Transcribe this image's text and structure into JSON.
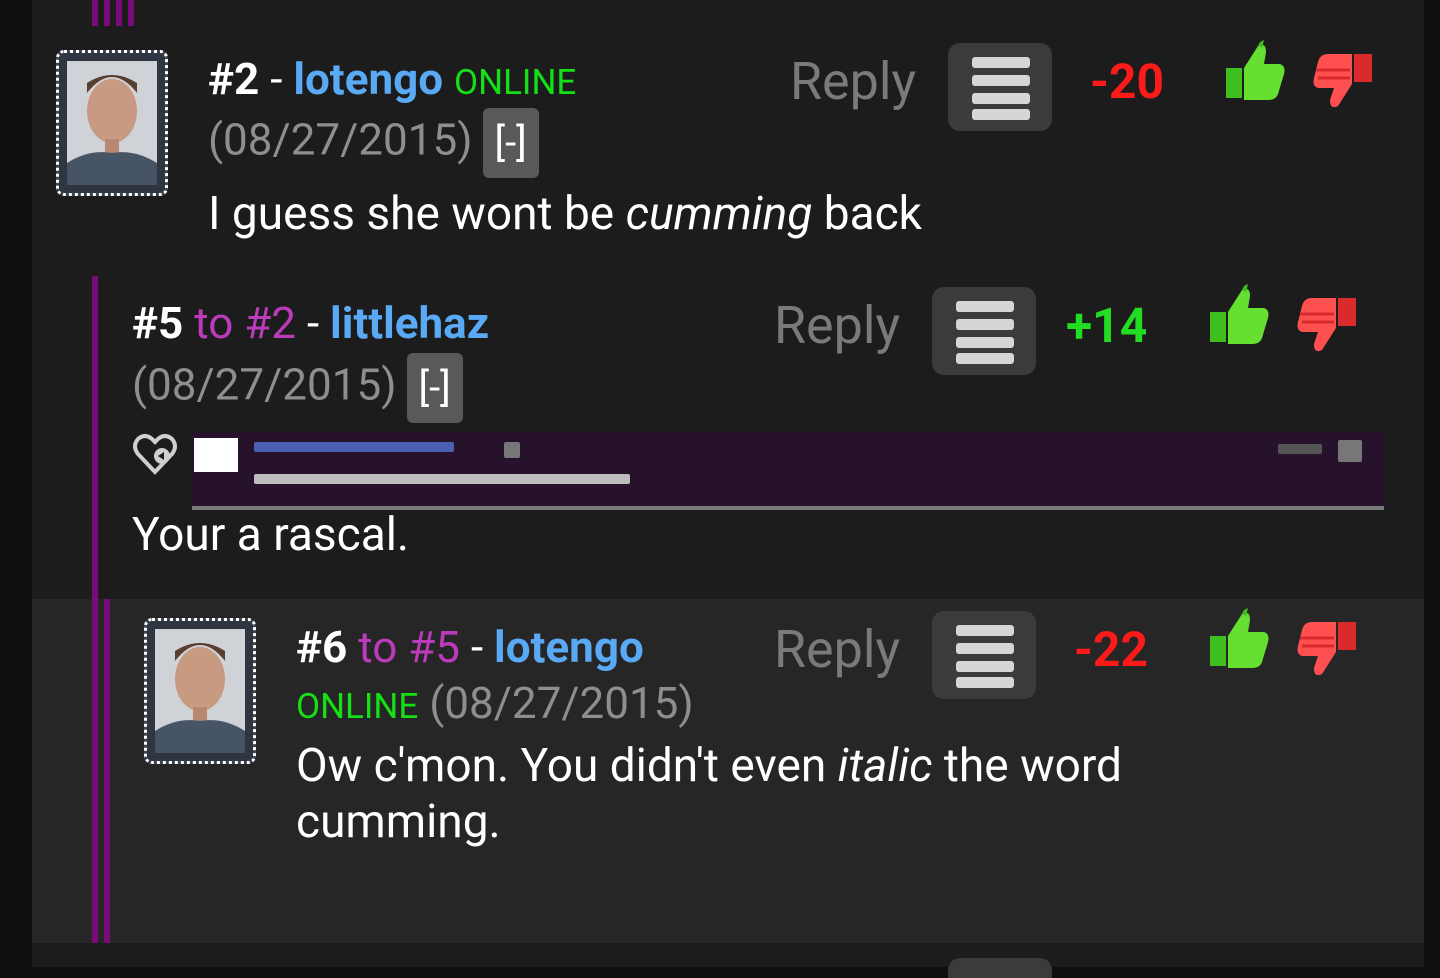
{
  "comments": [
    {
      "number": "#2",
      "username": "lotengo",
      "online": "ONLINE",
      "date": "(08/27/2015)",
      "collapse": "[-]",
      "reply": "Reply",
      "score": "-20",
      "body_parts": [
        "I guess she wont be ",
        "cumming",
        " back"
      ]
    },
    {
      "number": "#5",
      "to_label": "to #2",
      "username": "littlehaz",
      "date": "(08/27/2015)",
      "collapse": "[-]",
      "reply": "Reply",
      "score": "+14",
      "body": "Your a rascal."
    },
    {
      "number": "#6",
      "to_label": "to #5",
      "username": "lotengo",
      "online": "ONLINE",
      "date": "(08/27/2015)",
      "reply": "Reply",
      "score": "-22",
      "body_parts": [
        "Ow c'mon. You didn't even ",
        "italic",
        " the word",
        "cumming."
      ]
    }
  ],
  "colors": {
    "background": "#1c1c1c",
    "username": "#5aa9f5",
    "online": "#15e015",
    "reply_ref": "#bb3bbb",
    "negative_score": "#ff1a1a",
    "positive_score": "#22dd22",
    "thread_stripe": "#7a0a7a"
  },
  "icons": {
    "menu": "hamburger-icon",
    "upvote": "thumbs-up-icon",
    "downvote": "thumbs-down-icon",
    "quote": "heart-reply-icon"
  }
}
